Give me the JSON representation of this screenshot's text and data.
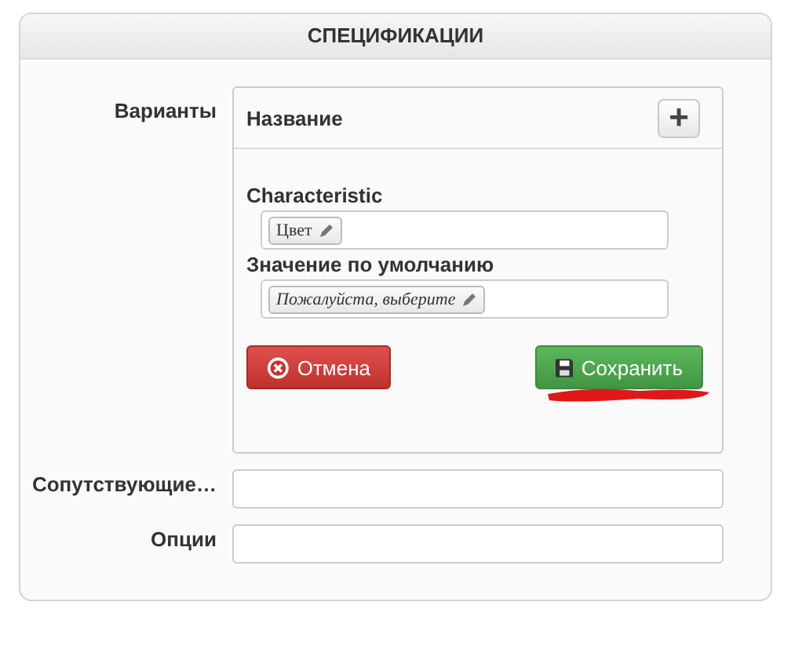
{
  "panel": {
    "title": "СПЕЦИФИКАЦИИ"
  },
  "variants": {
    "label": "Варианты",
    "header": "Название",
    "add_button": "+",
    "fields": [
      {
        "label": "Characteristic",
        "tag": "Цвет",
        "placeholder": false
      },
      {
        "label": "Значение по умолчанию",
        "tag": "Пожалуйста, выберите",
        "placeholder": true
      }
    ],
    "cancel_button": "Отмена",
    "save_button": "Сохранить"
  },
  "rows": [
    {
      "label": "Сопутствующие…"
    },
    {
      "label": "Опции"
    }
  ]
}
